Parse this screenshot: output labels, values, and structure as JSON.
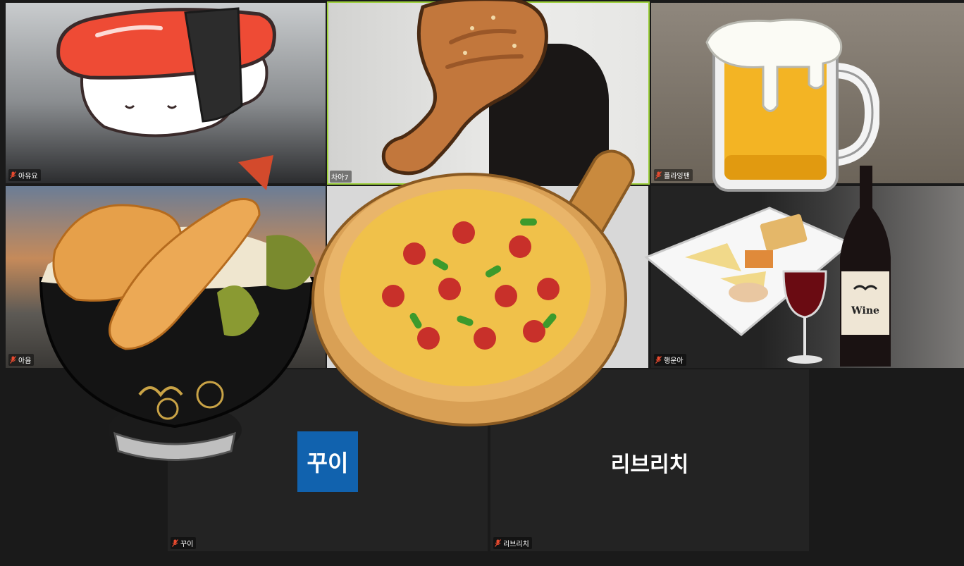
{
  "meeting": {
    "participants": [
      {
        "name": "아유요",
        "muted": true
      },
      {
        "name": "차아7",
        "muted": false,
        "active_speaker": true
      },
      {
        "name": "플라잉팬",
        "muted": true
      },
      {
        "name": "아윰",
        "muted": true
      },
      {
        "name": "",
        "muted": false
      },
      {
        "name": "행운아",
        "muted": true
      },
      {
        "name": "꾸이",
        "muted": true,
        "avatar_text": "꾸이",
        "avatar_color": "#1162ae"
      },
      {
        "name": "리브리치",
        "muted": true,
        "center_text": "리브리치"
      }
    ]
  },
  "stickers": {
    "sushi": {
      "icon": "sushi-icon"
    },
    "chicken": {
      "icon": "chicken-leg-icon"
    },
    "beer": {
      "icon": "beer-mug-icon"
    },
    "tempura": {
      "icon": "tempura-bowl-icon"
    },
    "pizza": {
      "icon": "pizza-icon"
    },
    "wine": {
      "icon": "wine-cheese-icon",
      "label": "Wine"
    }
  },
  "colors": {
    "active_border": "#9ccf3a",
    "background": "#1a1a1a",
    "mute_icon": "#e84a2f"
  }
}
